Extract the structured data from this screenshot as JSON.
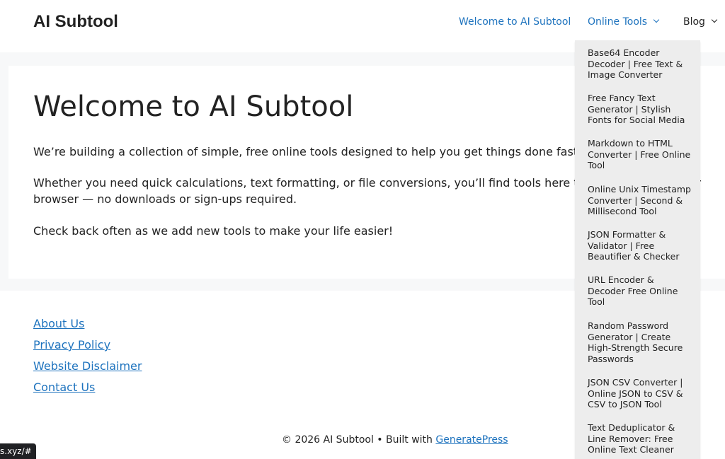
{
  "site": {
    "title": "AI Subtool"
  },
  "nav": {
    "welcome": "Welcome to AI Subtool",
    "tools": "Online Tools",
    "blog": "Blog"
  },
  "dropdown": {
    "items": [
      "Base64 Encoder Decoder | Free Text & Image Converter",
      "Free Fancy Text Generator | Stylish Fonts for Social Media",
      "Markdown to HTML Converter | Free Online Tool",
      "Online Unix Timestamp Converter | Second & Millisecond Tool",
      "JSON Formatter & Validator | Free Beautifier & Checker",
      "URL Encoder & Decoder Free Online Tool",
      "Random Password Generator | Create High-Strength Secure Passwords",
      "JSON CSV Converter | Online JSON to CSV & CSV to JSON Tool",
      "Text Deduplicator & Line Remover: Free Online Text Cleaner"
    ]
  },
  "main": {
    "title": "Welcome to AI Subtool",
    "paragraphs": [
      "We’re building a collection of simple, free online tools designed to help you get things done faster.",
      "Whether you need quick calculations, text formatting, or file conversions, you’ll find tools here that work right in your browser — no downloads or sign-ups required.",
      "Check back often as we add new tools to make your life easier!"
    ]
  },
  "footer": {
    "links": [
      "About Us",
      "Privacy Policy",
      "Website Disclaimer",
      "Contact Us"
    ],
    "copyright": "© 2026 AI Subtool • Built with ",
    "builder": "GeneratePress"
  },
  "status": {
    "url": "s.xyz/#"
  },
  "colors": {
    "accent": "#1e73be",
    "dropdown_bg": "#ededed",
    "page_bg": "#f7f8f9"
  },
  "icons": {
    "dropdown_indicator": "chevron-down-icon"
  }
}
